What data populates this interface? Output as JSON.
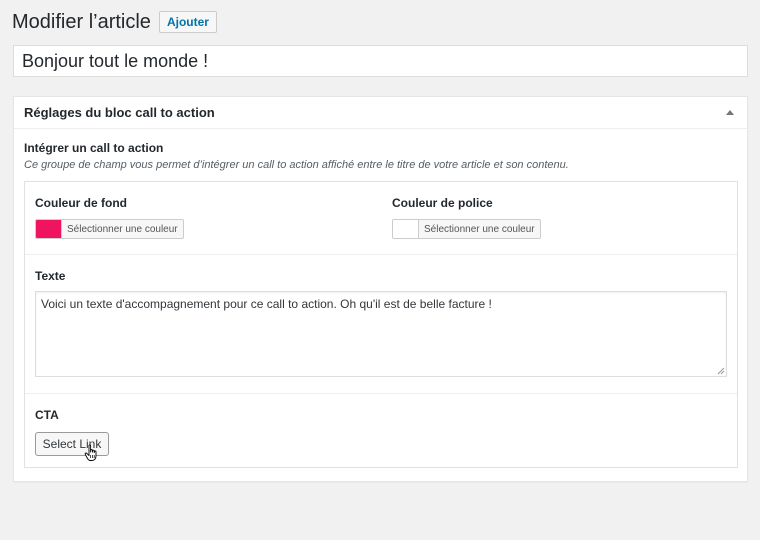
{
  "header": {
    "title": "Modifier l’article",
    "add_button": "Ajouter"
  },
  "post": {
    "title_value": "Bonjour tout le monde !"
  },
  "metabox": {
    "title": "Réglages du bloc call to action",
    "toggle_icon": "arrow-up-icon",
    "group": {
      "label": "Intégrer un call to action",
      "description": "Ce groupe de champ vous permet d’intégrer un call to action affiché entre le titre de votre article et son contenu."
    },
    "fields": {
      "background_color": {
        "label": "Couleur de fond",
        "button_label": "Sélectionner une couleur",
        "color": "#f0135f"
      },
      "font_color": {
        "label": "Couleur de police",
        "button_label": "Sélectionner une couleur",
        "color": "#ffffff"
      },
      "text": {
        "label": "Texte",
        "value": "Voici un texte d'accompagnement pour ce call to action. Oh qu'il est de belle facture !"
      },
      "cta": {
        "label": "CTA",
        "button_label": "Select Link"
      }
    }
  },
  "cursor": {
    "icon": "hand-pointer-icon"
  }
}
